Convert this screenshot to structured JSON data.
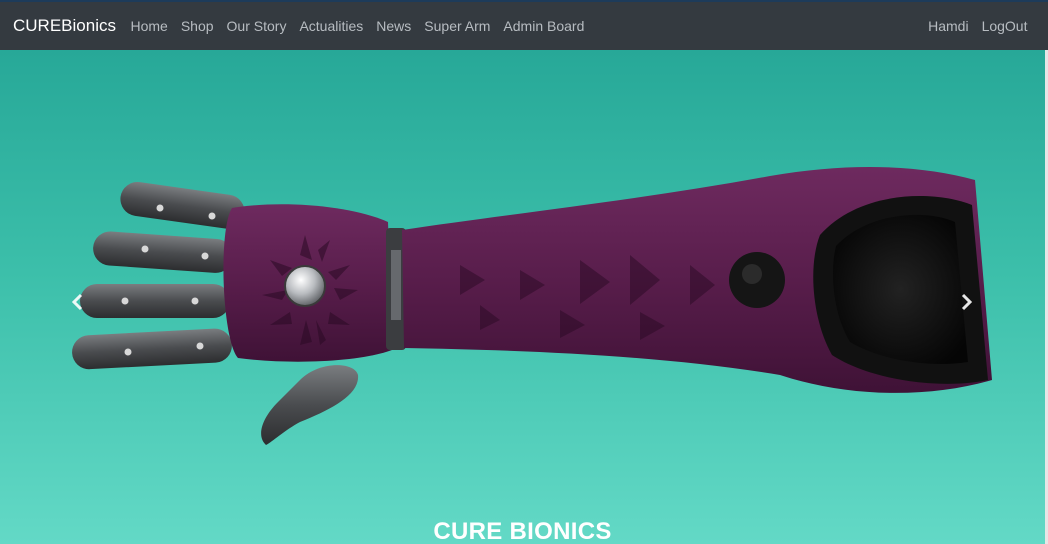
{
  "navbar": {
    "brand": "CUREBionics",
    "links": [
      {
        "label": "Home"
      },
      {
        "label": "Shop"
      },
      {
        "label": "Our Story"
      },
      {
        "label": "Actualities"
      },
      {
        "label": "News"
      },
      {
        "label": "Super Arm"
      },
      {
        "label": "Admin Board"
      }
    ],
    "user_label": "Hamdi",
    "logout_label": "LogOut"
  },
  "carousel": {
    "prev_icon": "chevron-left-icon",
    "next_icon": "chevron-right-icon",
    "caption": "CURE BIONICS"
  },
  "colors": {
    "navbar_bg": "#343a40",
    "hero_top": "#27a898",
    "hero_bottom": "#63d9c6",
    "arm_purple": "#5a1f4c"
  }
}
